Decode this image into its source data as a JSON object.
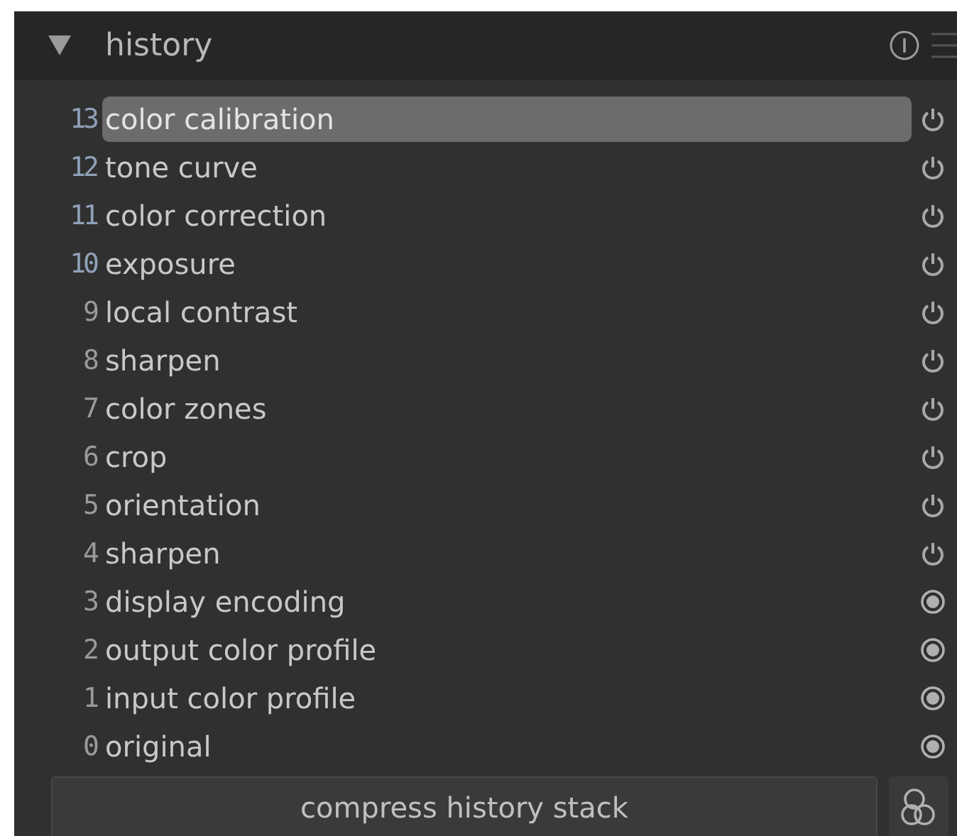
{
  "header": {
    "title": "history",
    "expanded": true
  },
  "items": [
    {
      "number": "13",
      "label": "color calibration",
      "selected": true,
      "color": "#8fa0b8",
      "kind": "power"
    },
    {
      "number": "12",
      "label": "tone curve",
      "selected": false,
      "color": "#8fa0b8",
      "kind": "power"
    },
    {
      "number": "11",
      "label": "color correction",
      "selected": false,
      "color": "#8fa0b8",
      "kind": "power"
    },
    {
      "number": "10",
      "label": "exposure",
      "selected": false,
      "color": "#8fa0b8",
      "kind": "power"
    },
    {
      "number": "9",
      "label": "local contrast",
      "selected": false,
      "color": "#9a9a9a",
      "kind": "power"
    },
    {
      "number": "8",
      "label": "sharpen",
      "selected": false,
      "color": "#9a9a9a",
      "kind": "power"
    },
    {
      "number": "7",
      "label": "color zones",
      "selected": false,
      "color": "#9a9a9a",
      "kind": "power"
    },
    {
      "number": "6",
      "label": "crop",
      "selected": false,
      "color": "#9a9a9a",
      "kind": "power"
    },
    {
      "number": "5",
      "label": "orientation",
      "selected": false,
      "color": "#9a9a9a",
      "kind": "power"
    },
    {
      "number": "4",
      "label": "sharpen",
      "selected": false,
      "color": "#9a9a9a",
      "kind": "power"
    },
    {
      "number": "3",
      "label": "display encoding",
      "selected": false,
      "color": "#9a9a9a",
      "kind": "default"
    },
    {
      "number": "2",
      "label": "output color profile",
      "selected": false,
      "color": "#9a9a9a",
      "kind": "default"
    },
    {
      "number": "1",
      "label": "input color profile",
      "selected": false,
      "color": "#9a9a9a",
      "kind": "default"
    },
    {
      "number": "0",
      "label": "original",
      "selected": false,
      "color": "#9a9a9a",
      "kind": "default"
    }
  ],
  "compress_button": "compress history stack"
}
